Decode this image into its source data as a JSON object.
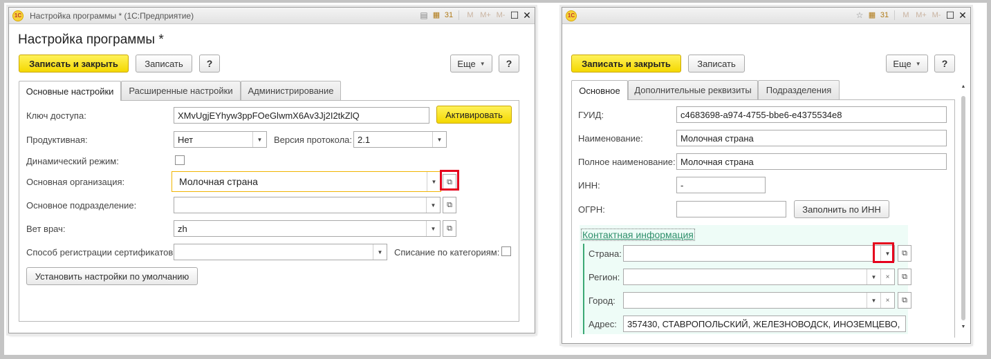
{
  "left_window": {
    "title": "Настройка программы * (1С:Предприятие)",
    "heading": "Настройка программы *",
    "toolbar": {
      "save_close": "Записать и закрыть",
      "save": "Записать",
      "help": "?",
      "more": "Еще",
      "help2": "?"
    },
    "tabs": [
      "Основные настройки",
      "Расширенные настройки",
      "Администрирование"
    ],
    "form": {
      "access_key_label": "Ключ доступа:",
      "access_key_value": "XMvUgjEYhyw3ppFOeGlwmX6Av3Jj2I2tkZlQ",
      "activate_button": "Активировать",
      "productive_label": "Продуктивная:",
      "productive_value": "Нет",
      "protocol_label": "Версия протокола:",
      "protocol_value": "2.1",
      "dynamic_label": "Динамический режим:",
      "org_label": "Основная организация:",
      "org_value": "Молочная страна",
      "dept_label": "Основное подразделение:",
      "dept_value": "",
      "vet_label": "Вет врач:",
      "vet_value": "zh",
      "cert_label": "Способ регистрации сертификатов:",
      "cert_value": "",
      "writeoff_label": "Списание по категориям:",
      "defaults_button": "Установить настройки по умолчанию"
    }
  },
  "right_window": {
    "title": "",
    "toolbar": {
      "save_close": "Записать и закрыть",
      "save": "Записать",
      "more": "Еще",
      "help": "?"
    },
    "tabs": [
      "Основное",
      "Дополнительные реквизиты",
      "Подразделения"
    ],
    "form": {
      "guid_label": "ГУИД:",
      "guid_value": "c4683698-a974-4755-bbe6-e4375534e8",
      "name_label": "Наименование:",
      "name_value": "Молочная страна",
      "fullname_label": "Полное наименование:",
      "fullname_value": "Молочная страна",
      "inn_label": "ИНН:",
      "inn_value": "-",
      "ogrn_label": "ОГРН:",
      "ogrn_value": "",
      "fill_inn_button": "Заполнить по ИНН",
      "contact_title": "Контактная информация",
      "country_label": "Страна:",
      "country_value": "",
      "region_label": "Регион:",
      "region_value": "",
      "city_label": "Город:",
      "city_value": "",
      "address_label": "Адрес:",
      "address_value": "357430, СТАВРОПОЛЬСКИЙ, ЖЕЛЕЗНОВОДСК, ИНОЗЕМЦЕВО,"
    }
  },
  "icons": {
    "dropdown": "▼",
    "open": "⧉",
    "clear": "×",
    "window_max": "☐",
    "window_close": "✕",
    "star": "☆",
    "doc": "▤",
    "calendar": "31",
    "m": "M",
    "m_plus": "M+",
    "m_minus": "M-",
    "scroll_up": "▲",
    "scroll_down": "▼",
    "logo": "1С"
  },
  "colors": {
    "primary_button": "#f4d800",
    "focus_border": "#f0b400",
    "highlight_red": "#e5001c",
    "group_bg": "#eefcf7",
    "group_title": "#2e8f6b"
  }
}
